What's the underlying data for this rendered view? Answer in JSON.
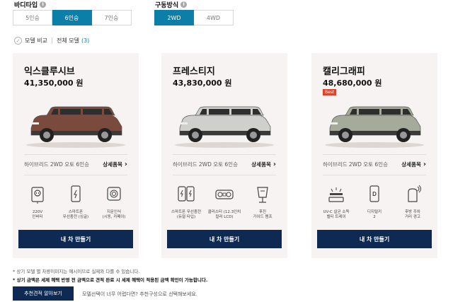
{
  "filters": {
    "body_type": {
      "label": "바디타입",
      "options": [
        "5인승",
        "6인승",
        "7인승"
      ],
      "selected": "6인승"
    },
    "drive_type": {
      "label": "구동방식",
      "options": [
        "2WD",
        "4WD"
      ],
      "selected": "2WD"
    }
  },
  "compare": {
    "label": "모델 비교",
    "all_models": "전체 모델",
    "count": "(3)"
  },
  "cards": [
    {
      "name": "익스클루시브",
      "price": "41,350,000 원",
      "badge": "",
      "car_color": "#7a4a3c",
      "trim": "하이브리드 2WD 오토 6인승",
      "detail": "상세품목",
      "features": [
        {
          "icon": "outlet-icon",
          "label": "220V\n인버터"
        },
        {
          "icon": "phone-icon",
          "label": "스마트폰\n무선충전 (싱글)"
        },
        {
          "icon": "fingerprint-icon",
          "label": "지문인식\n(시동, 카페이)"
        }
      ],
      "cta": "내 차 만들기"
    },
    {
      "name": "프레스티지",
      "price": "43,830,000 원",
      "badge": "",
      "car_color": "#cfd0cb",
      "trim": "하이브리드 2WD 오토 6인승",
      "detail": "상세품목",
      "features": [
        {
          "icon": "dual-phone-icon",
          "label": "스마트폰 무선충전\n(듀얼 타입)"
        },
        {
          "icon": "cluster-icon",
          "label": "클러스터 (12.3인치\n컬러 LCD)"
        },
        {
          "icon": "tail-lamp-icon",
          "label": "후진\n가이드 램프"
        }
      ],
      "cta": "내 차 만들기"
    },
    {
      "name": "캘리그래피",
      "price": "48,680,000 원",
      "badge": "Best",
      "car_color": "#a6aa9a",
      "trim": "하이브리드 2WD 오토 6인승",
      "detail": "상세품목",
      "features": [
        {
          "icon": "uv-lamp-icon",
          "label": "UV-C 살균 소독\n벨티 트레이"
        },
        {
          "icon": "digital-key-icon",
          "label": "디지털키\n2"
        },
        {
          "icon": "rear-alert-icon",
          "label": "후방 주차\n거리 경고"
        }
      ],
      "cta": "내 차 만들기"
    }
  ],
  "notes": [
    "* 상기 모델 별 차량이미지는 예시이므로 실제와 다를 수 있습니다.",
    "* 상기 금액은 세제 혜택 반영 전 금액으로 견적 완료 시 세제 혜택이 적용된 금액 확인이 가능합니다."
  ],
  "recommend": {
    "button": "추천견적 알아보기",
    "text": "모델선택이 너무 어렵다면? 추천구성으로 선택해보세요."
  }
}
